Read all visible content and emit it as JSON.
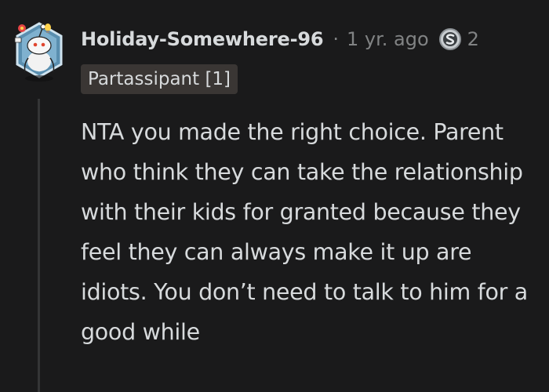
{
  "comment": {
    "username": "Holiday-Somewhere-96",
    "separator": "·",
    "age": "1 yr. ago",
    "award": {
      "icon": "silver-award-icon",
      "count": "2"
    },
    "flair": "Partassipant [1]",
    "body": "NTA you made the right choice. Parent who think they can take the relationship with their kids for granted because they feel they can always make it up are idiots. You don’t need to talk to him for a good while"
  },
  "avatar": {
    "icon": "snoo-avatar-icon"
  },
  "colors": {
    "background": "#1a1a1b",
    "text": "#d7dadc",
    "muted": "#818384",
    "flair_bg": "#3a3634",
    "thread_line": "#343536"
  }
}
